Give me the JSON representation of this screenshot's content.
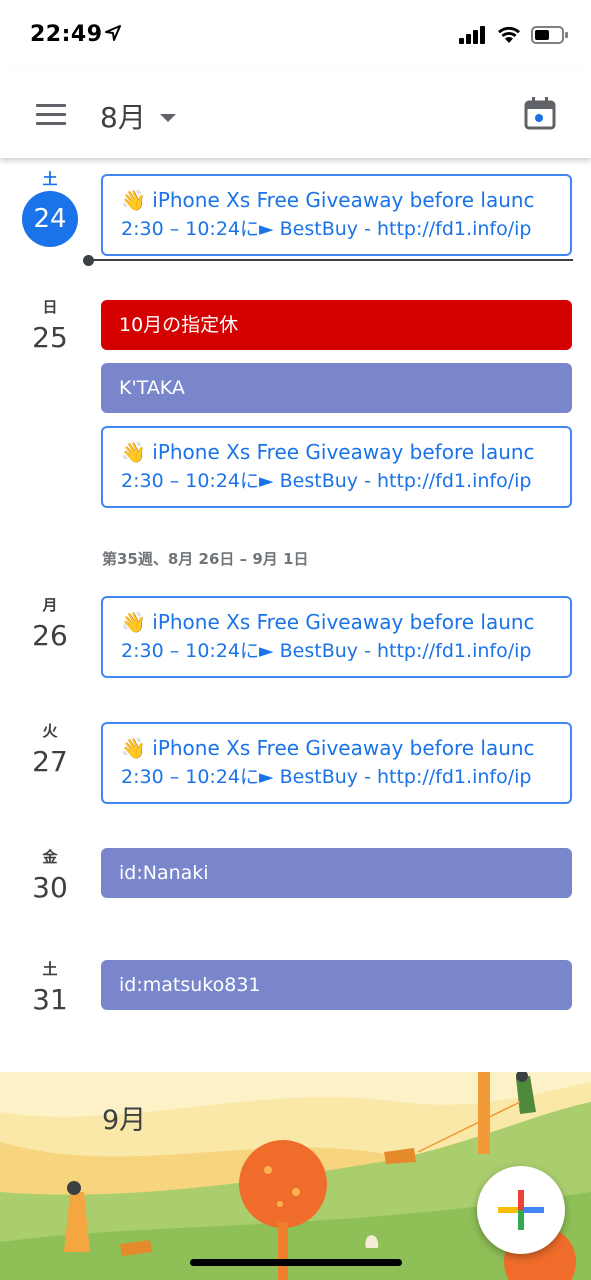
{
  "status_bar": {
    "time": "22:49"
  },
  "app_bar": {
    "month": "8月"
  },
  "days": [
    {
      "dow": "土",
      "date": "24",
      "today": true
    },
    {
      "dow": "日",
      "date": "25"
    },
    {
      "dow": "月",
      "date": "26"
    },
    {
      "dow": "火",
      "date": "27"
    },
    {
      "dow": "金",
      "date": "30"
    },
    {
      "dow": "土",
      "date": "31"
    }
  ],
  "events": {
    "giveaway": {
      "emoji": "👋",
      "title": "iPhone Xs Free Giveaway before launc",
      "detail": "2:30 – 10:24に► BestBuy - http://fd1.info/ip"
    },
    "holiday": "10月の指定休",
    "ktaka": "K'TAKA",
    "nanaki": "id:Nanaki",
    "matsuko": "id:matsuko831"
  },
  "week_label": "第35週、8月 26日 – 9月 1日",
  "september": {
    "title": "9月"
  },
  "colors": {
    "accent": "#1a73e8",
    "event_red": "#d50000",
    "event_lavender": "#7986cb"
  },
  "icons": [
    "location-arrow-icon",
    "signal-icon",
    "wifi-icon",
    "battery-icon",
    "menu-icon",
    "chevron-down-icon",
    "calendar-today-icon",
    "add-icon"
  ]
}
